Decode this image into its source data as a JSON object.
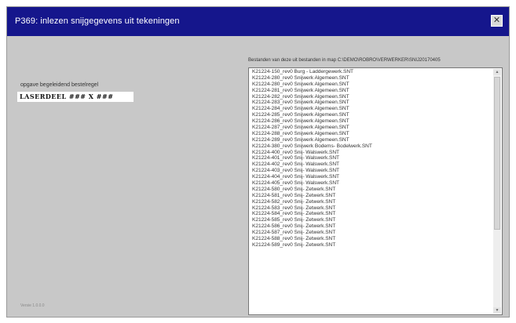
{
  "window": {
    "title": "P369: inlezen snijgegevens uit tekeningen",
    "close_glyph": "✕"
  },
  "source": {
    "label": "Bestanden van deze uit bestanden in map C:\\DEMO\\ROBRO\\VERWERKER\\SNIJ20170405"
  },
  "field": {
    "label": "opgave begeleidend bestelregel",
    "value": "LASERDEEL ### X ###"
  },
  "footer": {
    "version": "Versie 1.0.0.0"
  },
  "list": {
    "items": [
      "K21224-150_rev0 Burg - Laddergewerk.SNT",
      "K21224-280_rev0 Snijwerk Algemeen.SNT",
      "K21224-280_rev0 Snijwerk Algemeen.SNT",
      "K21224-281_rev0 Snijwerk Algemeen.SNT",
      "K21224-282_rev0 Snijwerk Algemeen.SNT",
      "K21224-283_rev0 Snijwerk Algemeen.SNT",
      "K21224-284_rev0 Snijwerk Algemeen.SNT",
      "K21224-285_rev0 Snijwerk Algemeen.SNT",
      "K21224-286_rev0 Snijwerk Algemeen.SNT",
      "K21224-287_rev0 Snijwerk Algemeen.SNT",
      "K21224-288_rev0 Snijwerk Algemeen.SNT",
      "K21224-289_rev0 Snijwerk Algemeen.SNT",
      "K21224-380_rev0 Snijwerk Bodems- Bodelwerk.SNT",
      "K21224-400_rev0 Snij- Walswerk.SNT",
      "K21224-401_rev0 Snij- Walswerk.SNT",
      "K21224-402_rev0 Snij- Walswerk.SNT",
      "K21224-403_rev0 Snij- Walswerk.SNT",
      "K21224-404_rev0 Snij- Walswerk.SNT",
      "K21224-405_rev0 Snij- Walswerk.SNT",
      "K21224-580_rev0 Snij- Zetwerk.SNT",
      "K21224-581_rev0 Snij- Zetwerk.SNT",
      "K21224-582_rev0 Snij- Zetwerk.SNT",
      "K21224-583_rev0 Snij- Zetwerk.SNT",
      "K21224-584_rev0 Snij- Zetwerk.SNT",
      "K21224-585_rev0 Snij- Zetwerk.SNT",
      "K21224-586_rev0 Snij- Zetwerk.SNT",
      "K21224-587_rev0 Snij- Zetwerk.SNT",
      "K21224-588_rev0 Snij- Zetwerk.SNT",
      "K21224-589_rev0 Snij- Zetwerk.SNT"
    ]
  },
  "scrollbar": {
    "up_glyph": "▲",
    "down_glyph": "▼"
  }
}
